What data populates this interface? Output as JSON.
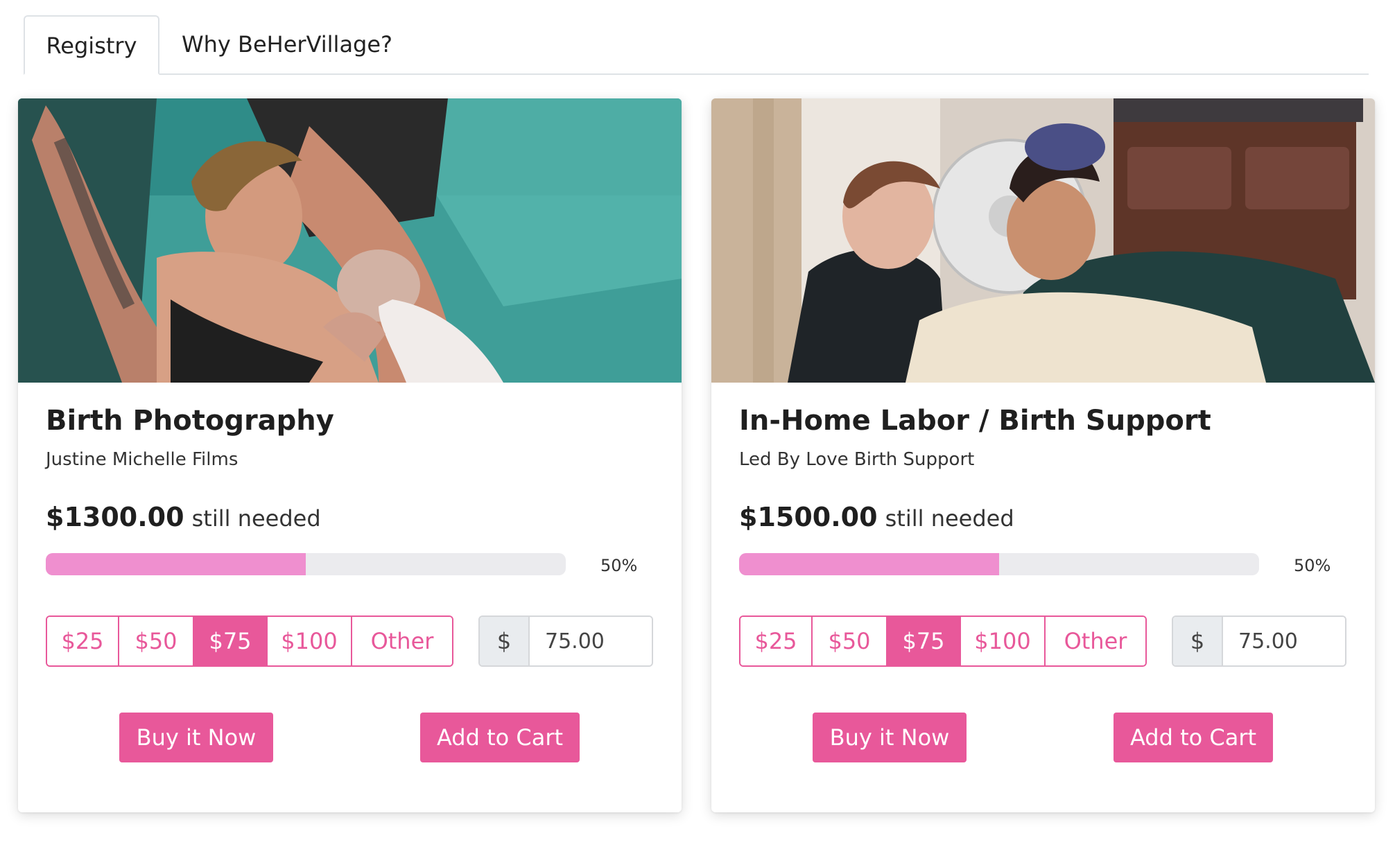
{
  "tabs": [
    {
      "label": "Registry",
      "active": true
    },
    {
      "label": "Why BeHerVillage?",
      "active": false
    }
  ],
  "colors": {
    "accent": "#e8589a",
    "progress": "#ef8fcf",
    "track": "#ebebee"
  },
  "cards": [
    {
      "title": "Birth Photography",
      "vendor": "Justine Michelle Films",
      "amount_needed": "$1300.00",
      "needed_label": "still needed",
      "progress_percent": 50,
      "progress_label": "50%",
      "amount_options": [
        "$25",
        "$50",
        "$75",
        "$100",
        "Other"
      ],
      "selected_option": "$75",
      "currency_symbol": "$",
      "custom_amount": "75.00",
      "buy_label": "Buy it Now",
      "cart_label": "Add to Cart"
    },
    {
      "title": "In-Home Labor / Birth Support",
      "vendor": "Led By Love Birth Support",
      "amount_needed": "$1500.00",
      "needed_label": "still needed",
      "progress_percent": 50,
      "progress_label": "50%",
      "amount_options": [
        "$25",
        "$50",
        "$75",
        "$100",
        "Other"
      ],
      "selected_option": "$75",
      "currency_symbol": "$",
      "custom_amount": "75.00",
      "buy_label": "Buy it Now",
      "cart_label": "Add to Cart"
    }
  ]
}
